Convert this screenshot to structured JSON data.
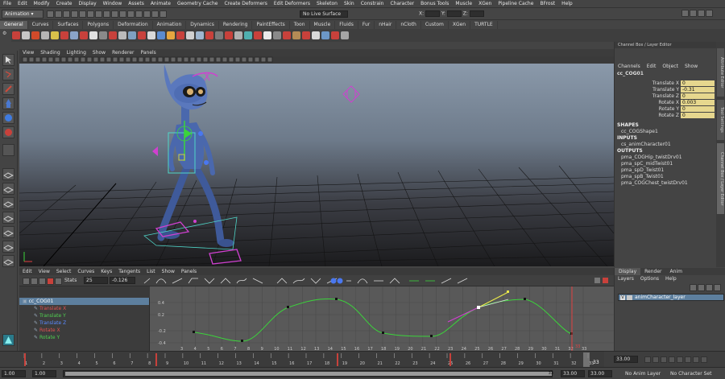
{
  "menubar": [
    "File",
    "Edit",
    "Modify",
    "Create",
    "Display",
    "Window",
    "Assets",
    "Animate",
    "Geometry Cache",
    "Create Deformers",
    "Edit Deformers",
    "Skeleton",
    "Skin",
    "Constrain",
    "Character",
    "Bonus Tools",
    "Muscle",
    "XGen",
    "Pipeline Cache",
    "BFrost",
    "Help"
  ],
  "status": {
    "mode": "Animation",
    "live_surface": "No Live Surface",
    "x_label": "X:",
    "y_label": "Y:",
    "z_label": "Z:"
  },
  "shelf_tabs": [
    "General",
    "Curves",
    "Surfaces",
    "Polygons",
    "Deformation",
    "Animation",
    "Dynamics",
    "Rendering",
    "PaintEffects",
    "Toon",
    "Muscle",
    "Fluids",
    "Fur",
    "nHair",
    "nCloth",
    "Custom",
    "XGen",
    "TURTLE"
  ],
  "shelf_colors": [
    "#c8413b",
    "#c6c6c6",
    "#d14a2a",
    "#b5b5b5",
    "#d8c14a",
    "#c8413b",
    "#8aa4c8",
    "#c8413b",
    "#e0e0e0",
    "#8a8a8a",
    "#c8413b",
    "#bbbbbb",
    "#7fa0c0",
    "#c8413b",
    "#d8d8d8",
    "#5a8bd0",
    "#e6a640",
    "#c8413b",
    "#d0d0d0",
    "#9fb6cf",
    "#c8413b",
    "#7b7b7b",
    "#c8413b",
    "#b0b0b0",
    "#4fb0b0",
    "#c8413b",
    "#eaeaea",
    "#8a8a8a",
    "#c8413b",
    "#b48b55",
    "#c8413b",
    "#d9d9d9",
    "#6c97c6",
    "#c8413b",
    "#a5a5a5"
  ],
  "viewport_menu": [
    "View",
    "Shading",
    "Lighting",
    "Show",
    "Renderer",
    "Panels"
  ],
  "channel_box": {
    "title": "Channel Box / Layer Editor",
    "menu": [
      "Channels",
      "Edit",
      "Object",
      "Show"
    ],
    "object": "cc_COG01",
    "channels": [
      {
        "label": "Translate X",
        "value": "0"
      },
      {
        "label": "Translate Y",
        "value": "-0.31"
      },
      {
        "label": "Translate Z",
        "value": "0"
      },
      {
        "label": "Rotate X",
        "value": "0.003"
      },
      {
        "label": "Rotate Y",
        "value": "0"
      },
      {
        "label": "Rotate Z",
        "value": "0"
      }
    ],
    "shapes_header": "SHAPES",
    "shapes": [
      "cc_COGShape1"
    ],
    "inputs_header": "INPUTS",
    "inputs": [
      "cs_animCharacter01"
    ],
    "outputs_header": "OUTPUTS",
    "outputs": [
      "pma_COGHip_twistDrv01",
      "pma_spC_midTwist01",
      "pma_spD_Twist01",
      "pma_spB_Twist01",
      "pma_COGChest_twistDrv01"
    ]
  },
  "side_tabs": [
    "Attribute Editor",
    "Tool Settings",
    "Channel Box / Layer Editor"
  ],
  "graph_editor": {
    "menu": [
      "Edit",
      "View",
      "Select",
      "Curves",
      "Keys",
      "Tangents",
      "List",
      "Show",
      "Panels"
    ],
    "stats_label": "Stats",
    "stats_a": "25",
    "stats_b": "-0.126",
    "outliner": [
      {
        "label": "cc_COG01",
        "color": "#ffffff",
        "selected": true
      },
      {
        "label": "Translate X",
        "color": "#e05050"
      },
      {
        "label": "Translate Y",
        "color": "#50d050"
      },
      {
        "label": "Translate Z",
        "color": "#5a8aff"
      },
      {
        "label": "Rotate X",
        "color": "#e05050"
      },
      {
        "label": "Rotate Y",
        "color": "#50d050"
      }
    ],
    "y_ticks": [
      "0.4",
      "0.2",
      "-0.2",
      "-0.4"
    ],
    "x_ticks": [
      "3",
      "4",
      "5",
      "6",
      "7",
      "8",
      "9",
      "10",
      "11",
      "12",
      "13",
      "14",
      "15",
      "16",
      "17",
      "18",
      "19",
      "20",
      "21",
      "22",
      "23",
      "24",
      "25",
      "26",
      "27",
      "28",
      "29",
      "30",
      "31",
      "32",
      "33"
    ],
    "current_frame": "33"
  },
  "layer_editor": {
    "tabs": [
      "Display",
      "Render",
      "Anim"
    ],
    "menu": [
      "Layers",
      "Options",
      "Help"
    ],
    "layers": [
      {
        "visible": "V",
        "name": "animCharacter_layer"
      }
    ]
  },
  "time_slider": {
    "ticks": [
      "1",
      "2",
      "3",
      "4",
      "5",
      "6",
      "7",
      "8",
      "9",
      "10",
      "11",
      "12",
      "13",
      "14",
      "15",
      "16",
      "17",
      "18",
      "19",
      "20",
      "21",
      "22",
      "23",
      "24",
      "25",
      "26",
      "27",
      "28",
      "29",
      "30",
      "31",
      "32",
      "33"
    ],
    "current": "33"
  },
  "range": {
    "start": "1.00",
    "inner_start": "1.00",
    "inner_end": "33",
    "end": "33.00",
    "right_field": "33.00",
    "anim_layer": "No Anim Layer",
    "character_set": "No Character Set"
  }
}
